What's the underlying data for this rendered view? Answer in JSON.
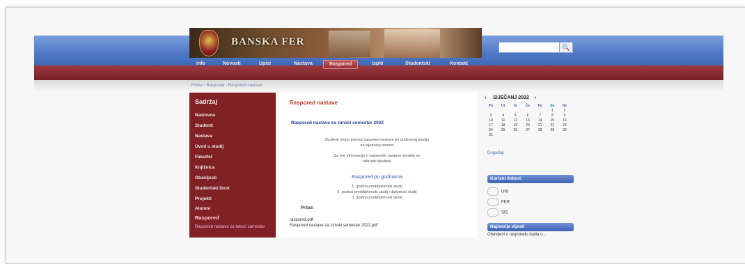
{
  "site": {
    "logo_text": "BANSKA FER",
    "search_button": "🔍",
    "search_placeholder": ""
  },
  "nav": {
    "items": [
      "Info",
      "Novosti",
      "Upisi",
      "Nastava",
      "Raspored",
      "Ispiti",
      "Studentski",
      "Kontakt"
    ],
    "active_index": 4
  },
  "breadcrumb": "Home › Raspored › Raspored nastave",
  "sidebar": {
    "title": "Sadržaj",
    "items": [
      "Naslovna",
      "Studenti",
      "Nastava",
      "Uvod u studij",
      "Fakultet",
      "Knjižnica",
      "Obavijesti",
      "Studentski život",
      "Projekti",
      "Alumni",
      "Raspored"
    ],
    "highlight": "Raspored",
    "sub_link": "Raspored nastave za tekući semestar"
  },
  "content": {
    "heading": "Raspored nastave",
    "subheading": "Raspored nastave za zimski semestar 2022",
    "para1_line1": "Studenti mogu pronaći raspored nastave po godinama studija",
    "para1_line2": "na sljedećoj stranici",
    "para2_line1": "Za sve informacije o rasporedu nastave obratite se",
    "para2_line2": "referadi fakulteta",
    "mid_title": "Raspored po godinama",
    "mid_line1": "1. godina preddiplomski studij",
    "mid_line2": "2. godina preddiplomski studij i diplomski studij",
    "mid_line3": "3. godina preddiplomski studij",
    "bottom_title": "Prilozi",
    "bottom_item1": "raspored.pdf",
    "bottom_item2": "Raspored nastave za zimski semestar 2022.pdf"
  },
  "calendar": {
    "month": "SIJEČANJ 2022",
    "prev": "‹",
    "next": "›",
    "dow": [
      "Po",
      "Ut",
      "Sr",
      "Če",
      "Pe",
      "Su",
      "Ne"
    ],
    "weeks": [
      [
        "",
        "",
        "",
        "",
        "",
        "1",
        "2"
      ],
      [
        "3",
        "4",
        "5",
        "6",
        "7",
        "8",
        "9"
      ],
      [
        "10",
        "11",
        "12",
        "13",
        "14",
        "15",
        "16"
      ],
      [
        "17",
        "18",
        "19",
        "20",
        "21",
        "22",
        "23"
      ],
      [
        "24",
        "25",
        "26",
        "27",
        "28",
        "29",
        "30"
      ],
      [
        "31",
        "",
        "",
        "",
        "",
        "",
        ""
      ]
    ],
    "footer": "Događaji"
  },
  "widgets": {
    "links_title": "Korisni linkovi",
    "links": [
      "UNI",
      "FER",
      "SIS"
    ],
    "news_title": "Najnovije vijesti",
    "news_line": "Obavijest o rasporedu ispita u..."
  },
  "colors": {
    "header_blue": "#4f78c4",
    "nav_red": "#7a1f25",
    "sidebar_red": "#7f2125",
    "widget_blue": "#3d63b0"
  }
}
